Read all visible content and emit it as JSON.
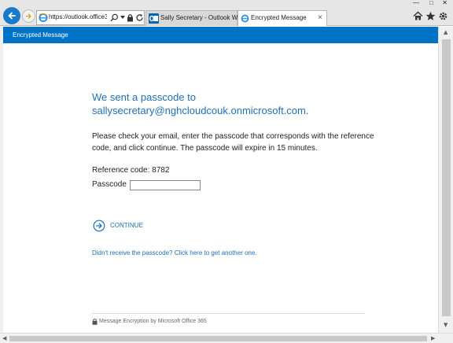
{
  "browser": {
    "address_url": "https://outlook.office3...",
    "tabs": [
      {
        "label": "Sally Secretary - Outlook Web ..."
      },
      {
        "label": "Encrypted Message",
        "close": "×"
      }
    ],
    "window_controls": {
      "minimize": "—",
      "maximize": "□",
      "close": "✕"
    }
  },
  "header": {
    "title": "Encrypted Message"
  },
  "main": {
    "heading_line1": "We sent a passcode to",
    "heading_line2": "sallysecretary@nghcloudcouk.onmicrosoft.com.",
    "instructions": "Please check your email, enter the passcode that corresponds with the reference code, and click continue. The passcode will expire in 15 minutes.",
    "reference_code": "Reference code: 8782",
    "passcode_label": "Passcode",
    "passcode_value": "",
    "continue_label": "CONTINUE",
    "resend_link": "Didn't receive the passcode? Click here to get another one."
  },
  "footer": {
    "text": "Message Encryption by Microsoft Office 365"
  },
  "colors": {
    "brand_blue": "#0072c6",
    "link_blue": "#1e6fb5",
    "nav_back_blue": "#1979ca"
  },
  "icons": [
    "back-arrow-icon",
    "forward-arrow-icon",
    "ie-favicon",
    "search-icon",
    "dropdown-icon",
    "lock-icon",
    "refresh-icon",
    "outlook-favicon",
    "ie-tab-favicon",
    "home-icon",
    "star-icon",
    "gear-icon",
    "continue-arrow-icon",
    "footer-lock-icon"
  ]
}
